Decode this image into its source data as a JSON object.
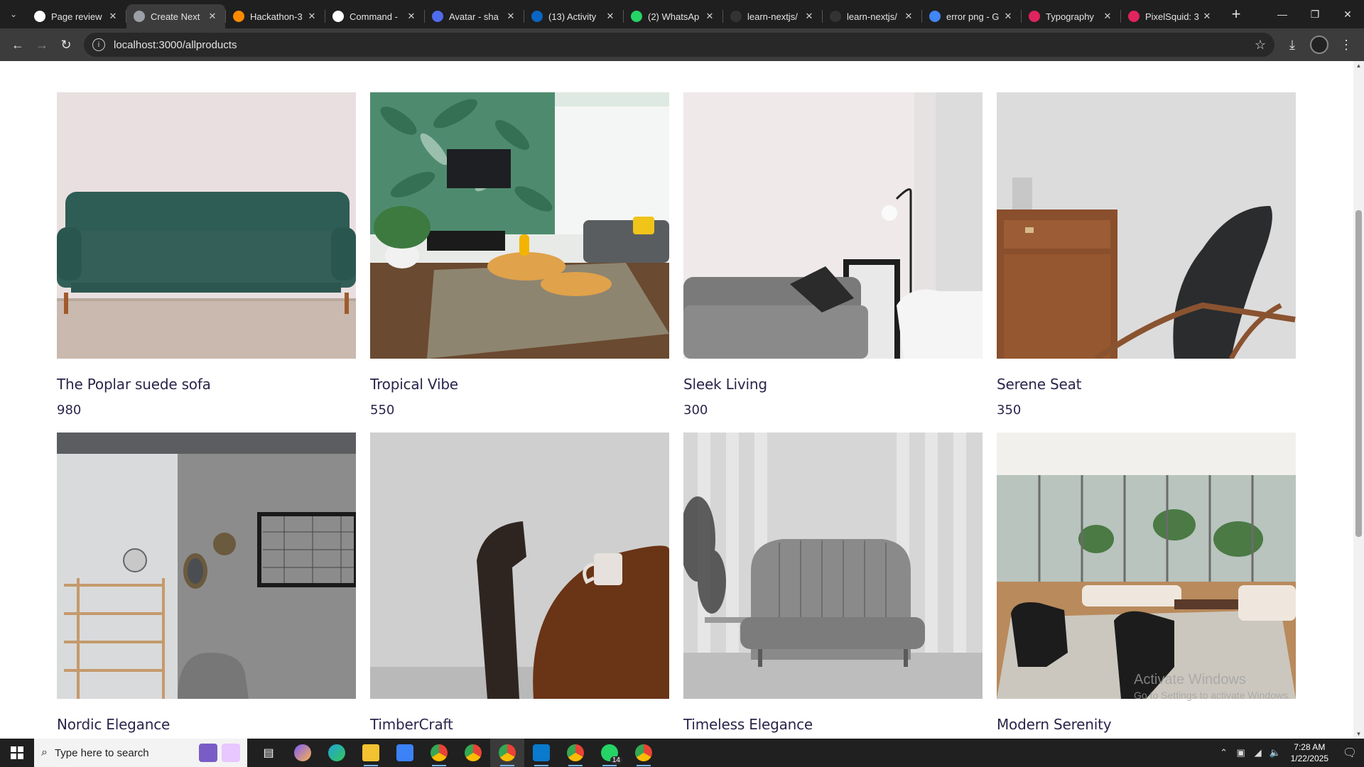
{
  "browser": {
    "tabs": [
      {
        "title": "Page review",
        "favicon": "openai-icon",
        "color": "#ffffff",
        "active": false
      },
      {
        "title": "Create Next",
        "favicon": "globe-icon",
        "color": "#9aa0a6",
        "active": true
      },
      {
        "title": "Hackathon-3",
        "favicon": "firebase-icon",
        "color": "#ff8a00",
        "active": false
      },
      {
        "title": "Command -",
        "favicon": "pen-icon",
        "color": "#ffffff",
        "active": false
      },
      {
        "title": "Avatar - sha",
        "favicon": "shadcn-icon",
        "color": "#4f6bed",
        "active": false
      },
      {
        "title": "(13) Activity",
        "favicon": "linkedin-icon",
        "color": "#0a66c2",
        "active": false
      },
      {
        "title": "(2) WhatsAp",
        "favicon": "whatsapp-icon",
        "color": "#25d366",
        "active": false
      },
      {
        "title": "learn-nextjs/",
        "favicon": "github-icon",
        "color": "#333333",
        "active": false
      },
      {
        "title": "learn-nextjs/",
        "favicon": "github-icon",
        "color": "#333333",
        "active": false
      },
      {
        "title": "error png - G",
        "favicon": "google-icon",
        "color": "#4285f4",
        "active": false
      },
      {
        "title": "Typography",
        "favicon": "figma-icon",
        "color": "#e0245e",
        "active": false
      },
      {
        "title": "PixelSquid: 3",
        "favicon": "pixelsquid-icon",
        "color": "#e0245e",
        "active": false
      }
    ],
    "url": "localhost:3000/allproducts"
  },
  "products": [
    {
      "name": "The Poplar suede sofa",
      "price": "980"
    },
    {
      "name": "Tropical Vibe",
      "price": "550"
    },
    {
      "name": "Sleek Living",
      "price": "300"
    },
    {
      "name": "Serene Seat",
      "price": "350"
    },
    {
      "name": "Nordic Elegance",
      "price": ""
    },
    {
      "name": "TimberCraft",
      "price": ""
    },
    {
      "name": "Timeless Elegance",
      "price": ""
    },
    {
      "name": "Modern Serenity",
      "price": ""
    }
  ],
  "watermark": {
    "title": "Activate Windows",
    "subtitle": "Go to Settings to activate Windows."
  },
  "taskbar": {
    "search_placeholder": "Type here to search",
    "time": "7:28 AM",
    "date": "1/22/2025",
    "whatsapp_badge": "14"
  },
  "colors": {
    "text_primary": "#2a254b",
    "chrome_dark": "#1f1f1f",
    "chrome_toolbar": "#3c3c3c"
  }
}
